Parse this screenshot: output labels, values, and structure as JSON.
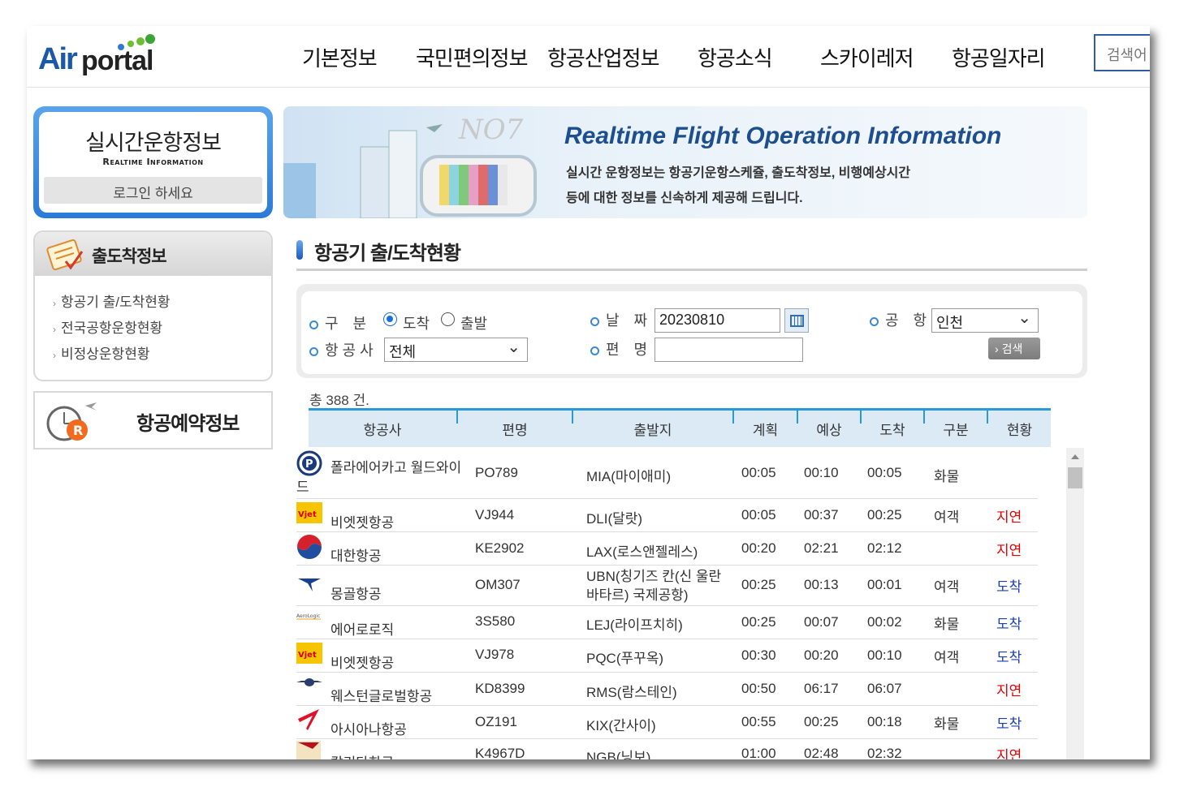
{
  "header": {
    "logo_air": "Air",
    "logo_portal": "portal",
    "nav": [
      "기본정보",
      "국민편의정보",
      "항공산업정보",
      "항공소식",
      "스카이레저",
      "항공일자리"
    ],
    "search_placeholder": "검색어"
  },
  "sidebar": {
    "realtime_title": "실시간운항정보",
    "realtime_subtitle": "Realtime Information",
    "login_label": "로그인 하세요",
    "arrival_title": "출도착정보",
    "links": [
      "항공기 출/도착현황",
      "전국공항운항현황",
      "비정상운항현황"
    ],
    "booking_title": "항공예약정보"
  },
  "banner": {
    "title": "Realtime Flight Operation Information",
    "line1": "실시간 운항정보는 항공기운항스케쥴, 출도착정보, 비행예상시간",
    "line2": "등에 대한 정보를 신속하게 제공해 드립니다."
  },
  "section_title": "항공기 출/도착현황",
  "search": {
    "type_label": "구　분",
    "radio_arrival": "도착",
    "radio_departure": "출발",
    "date_label": "날　짜",
    "date_value": "20230810",
    "airport_label": "공　항",
    "airport_value": "인천",
    "airline_label": "항 공 사",
    "airline_value": "전체",
    "flight_label": "편　명",
    "flight_value": "",
    "search_button": "검색"
  },
  "table": {
    "count": "총 388 건.",
    "headers": [
      "항공사",
      "편명",
      "출발지",
      "계획",
      "예상",
      "도착",
      "구분",
      "현황"
    ],
    "rows": [
      {
        "airline": "폴라에어카고 월드와이드",
        "flight": "PO789",
        "origin": "MIA(마이애미)",
        "plan": "00:05",
        "expected": "00:10",
        "arrival": "00:05",
        "type": "화물",
        "status": "",
        "logo": "polar-air-cargo-logo-icon"
      },
      {
        "airline": "비엣젯항공",
        "flight": "VJ944",
        "origin": "DLI(달랏)",
        "plan": "00:05",
        "expected": "00:37",
        "arrival": "00:25",
        "type": "여객",
        "status": "지연",
        "logo": "vietjet-logo-icon"
      },
      {
        "airline": "대한항공",
        "flight": "KE2902",
        "origin": "LAX(로스앤젤레스)",
        "plan": "00:20",
        "expected": "02:21",
        "arrival": "02:12",
        "type": "",
        "status": "지연",
        "logo": "korean-air-logo-icon"
      },
      {
        "airline": "몽골항공",
        "flight": "OM307",
        "origin": "UBN(칭기즈 칸(신 울란바타르) 국제공항)",
        "plan": "00:25",
        "expected": "00:13",
        "arrival": "00:01",
        "type": "여객",
        "status": "도착",
        "logo": "mongolian-airlines-logo-icon"
      },
      {
        "airline": "에어로로직",
        "flight": "3S580",
        "origin": "LEJ(라이프치히)",
        "plan": "00:25",
        "expected": "00:07",
        "arrival": "00:02",
        "type": "화물",
        "status": "도착",
        "logo": "aerologic-logo-icon"
      },
      {
        "airline": "비엣젯항공",
        "flight": "VJ978",
        "origin": "PQC(푸꾸옥)",
        "plan": "00:30",
        "expected": "00:20",
        "arrival": "00:10",
        "type": "여객",
        "status": "도착",
        "logo": "vietjet-logo-icon"
      },
      {
        "airline": "웨스턴글로벌항공",
        "flight": "KD8399",
        "origin": "RMS(람스테인)",
        "plan": "00:50",
        "expected": "06:17",
        "arrival": "06:07",
        "type": "",
        "status": "지연",
        "logo": "western-global-logo-icon"
      },
      {
        "airline": "아시아나항공",
        "flight": "OZ191",
        "origin": "KIX(간사이)",
        "plan": "00:55",
        "expected": "00:25",
        "arrival": "00:18",
        "type": "화물",
        "status": "도착",
        "logo": "asiana-logo-icon"
      },
      {
        "airline": "칼리타항공",
        "flight": "K4967D",
        "origin": "NGB(닝보)",
        "plan": "01:00",
        "expected": "02:48",
        "arrival": "02:32",
        "type": "",
        "status": "지연",
        "logo": "kalitta-logo-icon"
      }
    ]
  },
  "colors": {
    "brand_blue": "#1b58a8",
    "table_accent": "#2a9ad6",
    "delay": "#e00000",
    "arrived": "#1b3fb8"
  }
}
